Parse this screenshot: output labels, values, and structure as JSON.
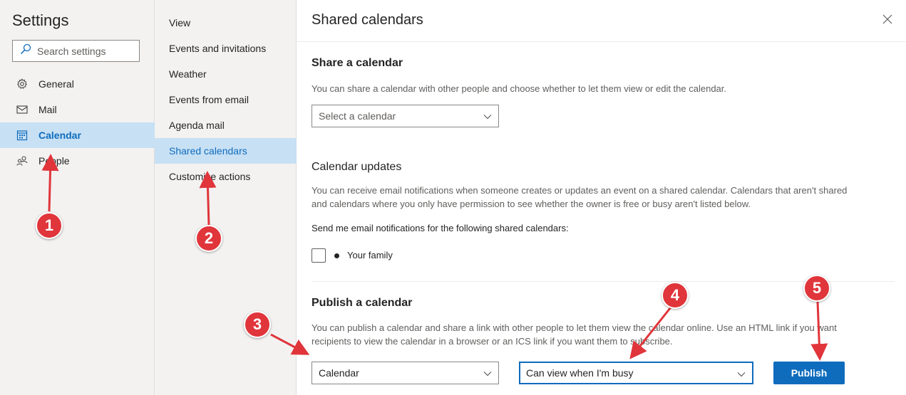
{
  "settings": {
    "title": "Settings",
    "search_placeholder": "Search settings",
    "nav": [
      {
        "label": "General",
        "icon": "gear-icon"
      },
      {
        "label": "Mail",
        "icon": "mail-icon"
      },
      {
        "label": "Calendar",
        "icon": "calendar-icon",
        "active": true
      },
      {
        "label": "People",
        "icon": "people-icon"
      }
    ]
  },
  "calendar_nav": {
    "items": [
      {
        "label": "View"
      },
      {
        "label": "Events and invitations"
      },
      {
        "label": "Weather"
      },
      {
        "label": "Events from email"
      },
      {
        "label": "Agenda mail"
      },
      {
        "label": "Shared calendars",
        "active": true
      },
      {
        "label": "Customize actions"
      }
    ]
  },
  "panel": {
    "title": "Shared calendars",
    "share": {
      "heading": "Share a calendar",
      "description": "You can share a calendar with other people and choose whether to let them view or edit the calendar.",
      "select_placeholder": "Select a calendar"
    },
    "updates": {
      "heading": "Calendar updates",
      "description_line1": "You can receive email notifications when someone creates or updates an event on a shared calendar. Calendars that aren't shared",
      "description_line2": "and calendars where you only have permission to see whether the owner is free or busy aren't listed below.",
      "notify_label": "Send me email notifications for the following shared calendars:",
      "calendars": [
        {
          "name": "Your family",
          "checked": false
        }
      ]
    },
    "publish": {
      "heading": "Publish a calendar",
      "description_line1": "You can publish a calendar and share a link with other people to let them view the calendar online. Use an HTML link if you want",
      "description_line2": "recipients to view the calendar in a browser or an ICS link if you want them to subscribe.",
      "calendar_select": "Calendar",
      "permission_select": "Can view when I'm busy",
      "button": "Publish"
    }
  },
  "annotations": {
    "badges": [
      "1",
      "2",
      "3",
      "4",
      "5"
    ],
    "color": "#e0353b"
  },
  "colors": {
    "accent": "#0f6cbd",
    "active_bg": "#c7e0f4",
    "nav_bg": "#f3f2f1"
  }
}
